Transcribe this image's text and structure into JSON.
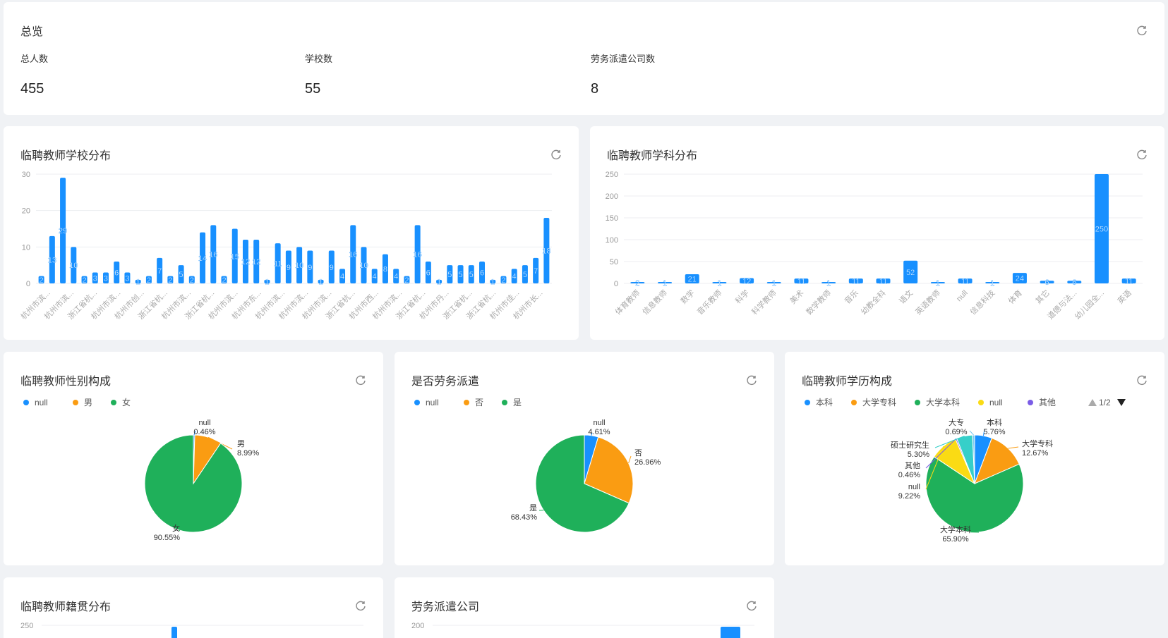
{
  "overview": {
    "title": "总览",
    "stats": [
      {
        "label": "总人数",
        "value": "455"
      },
      {
        "label": "学校数",
        "value": "55"
      },
      {
        "label": "劳务派遣公司数",
        "value": "8"
      }
    ]
  },
  "charts": {
    "school": {
      "title": "临聘教师学校分布",
      "chart_data": {
        "type": "bar",
        "ylim": [
          0,
          30
        ],
        "yticks": [
          0,
          10,
          20,
          30
        ],
        "values": [
          2,
          13,
          29,
          10,
          2,
          3,
          3,
          6,
          3,
          1,
          2,
          7,
          2,
          5,
          2,
          14,
          16,
          2,
          15,
          12,
          12,
          1,
          11,
          9,
          10,
          9,
          1,
          9,
          4,
          16,
          10,
          4,
          8,
          4,
          2,
          16,
          6,
          1,
          5,
          5,
          5,
          6,
          1,
          2,
          4,
          5,
          7,
          18
        ],
        "tick_labels": [
          "杭州市滨...",
          "杭州市滨...",
          "浙江省杭...",
          "杭州市滨...",
          "杭州市创...",
          "浙江省杭...",
          "杭州市滨...",
          "浙江省杭...",
          "杭州市滨...",
          "杭州市东...",
          "杭州市滨...",
          "杭州市滨...",
          "杭州市滨...",
          "浙江省杭...",
          "杭州市西...",
          "杭州市滨...",
          "浙江省杭...",
          "杭州市丹...",
          "浙江省杭...",
          "浙江省杭...",
          "杭州市佳...",
          "杭州市长..."
        ],
        "color": "#1890ff"
      }
    },
    "subject": {
      "title": "临聘教师学科分布",
      "chart_data": {
        "type": "bar",
        "ylim": [
          0,
          250
        ],
        "yticks": [
          0,
          50,
          100,
          150,
          200,
          250
        ],
        "categories": [
          "体育教师",
          "信息教师",
          "数学",
          "音乐教师",
          "科学",
          "科学教师",
          "美术",
          "数学教师",
          "音乐",
          "幼教全科",
          "语文",
          "英语教师",
          "null",
          "信息科技",
          "体育",
          "其它",
          "道德与法...",
          "幼儿园全...",
          "英语"
        ],
        "values": [
          2,
          1,
          21,
          1,
          12,
          1,
          11,
          1,
          11,
          11,
          52,
          1,
          11,
          1,
          24,
          6,
          6,
          250,
          11
        ],
        "color": "#1890ff"
      }
    },
    "gender": {
      "title": "临聘教师性别构成",
      "chart_data": {
        "type": "pie",
        "legend": [
          "null",
          "男",
          "女"
        ],
        "slices": [
          {
            "name": "null",
            "pct": 0.46,
            "label": "0.46%",
            "color": "#1890ff"
          },
          {
            "name": "男",
            "pct": 8.99,
            "label": "8.99%",
            "color": "#fa9c12"
          },
          {
            "name": "女",
            "pct": 90.55,
            "label": "90.55%",
            "color": "#1fb05a"
          }
        ]
      }
    },
    "dispatch": {
      "title": "是否劳务派遣",
      "chart_data": {
        "type": "pie",
        "legend": [
          "null",
          "否",
          "是"
        ],
        "slices": [
          {
            "name": "null",
            "pct": 4.61,
            "label": "4.61%",
            "color": "#1890ff"
          },
          {
            "name": "否",
            "pct": 26.96,
            "label": "26.96%",
            "color": "#fa9c12"
          },
          {
            "name": "是",
            "pct": 68.43,
            "label": "68.43%",
            "color": "#1fb05a"
          }
        ]
      }
    },
    "education": {
      "title": "临聘教师学历构成",
      "legend_page": "1/2",
      "chart_data": {
        "type": "pie",
        "legend": [
          "本科",
          "大学专科",
          "大学本科",
          "null",
          "其他"
        ],
        "slices": [
          {
            "name": "本科",
            "pct": 5.76,
            "label": "5.76%",
            "color": "#1890ff"
          },
          {
            "name": "大学专科",
            "pct": 12.67,
            "label": "12.67%",
            "color": "#fa9c12"
          },
          {
            "name": "大学本科",
            "pct": 65.9,
            "label": "65.90%",
            "color": "#1fb05a"
          },
          {
            "name": "null",
            "pct": 9.22,
            "label": "9.22%",
            "color": "#fadb14"
          },
          {
            "name": "其他",
            "pct": 0.46,
            "label": "0.46%",
            "color": "#7a5ce6"
          },
          {
            "name": "硕士研究生",
            "pct": 5.3,
            "label": "5.30%",
            "color": "#36cfc9"
          },
          {
            "name": "大专",
            "pct": 0.69,
            "label": "0.69%",
            "color": "#74c8f0"
          }
        ]
      }
    },
    "origin": {
      "title": "临聘教师籍贯分布",
      "chart_data": {
        "type": "bar",
        "yticks": [
          250
        ],
        "color": "#1890ff"
      }
    },
    "company": {
      "title": "劳务派遣公司",
      "chart_data": {
        "type": "bar",
        "yticks": [
          200
        ],
        "color": "#1890ff"
      }
    }
  }
}
